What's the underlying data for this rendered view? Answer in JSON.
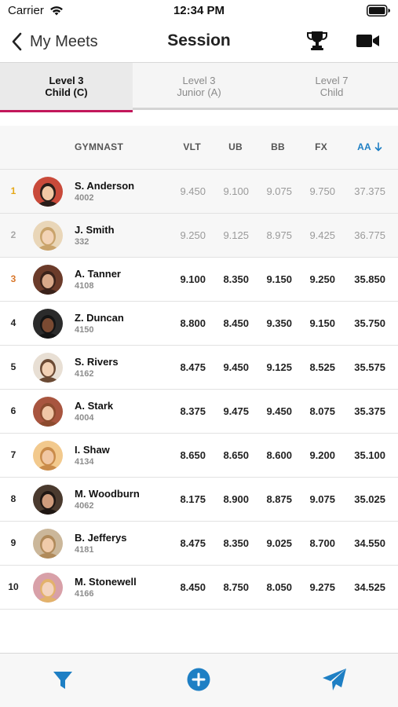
{
  "status_bar": {
    "carrier": "Carrier",
    "time": "12:34 PM",
    "icons": [
      "wifi-icon",
      "battery-icon"
    ]
  },
  "nav": {
    "back_label": "My Meets",
    "title": "Session",
    "icons": [
      "chevron-left-icon",
      "trophy-icon",
      "video-camera-icon"
    ]
  },
  "tabs": [
    {
      "line1": "Level 3",
      "line2": "Child (C)",
      "active": true
    },
    {
      "line1": "Level 3",
      "line2": "Junior (A)",
      "active": false
    },
    {
      "line1": "Level 7",
      "line2": "Child",
      "active": false
    }
  ],
  "columns": {
    "gymnast": "GYMNAST",
    "vlt": "VLT",
    "ub": "UB",
    "bb": "BB",
    "fx": "FX",
    "aa": "AA"
  },
  "rows": [
    {
      "rank": "1",
      "name": "S. Anderson",
      "number": "4002",
      "vlt": "9.450",
      "ub": "9.100",
      "bb": "9.075",
      "fx": "9.750",
      "aa": "37.375"
    },
    {
      "rank": "2",
      "name": "J. Smith",
      "number": "332",
      "vlt": "9.250",
      "ub": "9.125",
      "bb": "8.975",
      "fx": "9.425",
      "aa": "36.775"
    },
    {
      "rank": "3",
      "name": "A. Tanner",
      "number": "4108",
      "vlt": "9.100",
      "ub": "8.350",
      "bb": "9.150",
      "fx": "9.250",
      "aa": "35.850"
    },
    {
      "rank": "4",
      "name": "Z. Duncan",
      "number": "4150",
      "vlt": "8.800",
      "ub": "8.450",
      "bb": "9.350",
      "fx": "9.150",
      "aa": "35.750"
    },
    {
      "rank": "5",
      "name": "S. Rivers",
      "number": "4162",
      "vlt": "8.475",
      "ub": "9.450",
      "bb": "9.125",
      "fx": "8.525",
      "aa": "35.575"
    },
    {
      "rank": "6",
      "name": "A. Stark",
      "number": "4004",
      "vlt": "8.375",
      "ub": "9.475",
      "bb": "9.450",
      "fx": "8.075",
      "aa": "35.375"
    },
    {
      "rank": "7",
      "name": "I. Shaw",
      "number": "4134",
      "vlt": "8.650",
      "ub": "8.650",
      "bb": "8.600",
      "fx": "9.200",
      "aa": "35.100"
    },
    {
      "rank": "8",
      "name": "M. Woodburn",
      "number": "4062",
      "vlt": "8.175",
      "ub": "8.900",
      "bb": "8.875",
      "fx": "9.075",
      "aa": "35.025"
    },
    {
      "rank": "9",
      "name": "B. Jefferys",
      "number": "4181",
      "vlt": "8.475",
      "ub": "8.350",
      "bb": "9.025",
      "fx": "8.700",
      "aa": "34.550"
    },
    {
      "rank": "10",
      "name": "M. Stonewell",
      "number": "4166",
      "vlt": "8.450",
      "ub": "8.750",
      "bb": "8.050",
      "fx": "9.275",
      "aa": "34.525"
    }
  ],
  "bottom_bar": {
    "icons": [
      "filter-icon",
      "add-circle-icon",
      "send-icon"
    ]
  },
  "colors": {
    "accent": "#1e7fc4",
    "active_tab_underline": "#c2185b",
    "gold": "#e6a817",
    "silver": "#a8a8a8",
    "bronze": "#d9772b"
  }
}
